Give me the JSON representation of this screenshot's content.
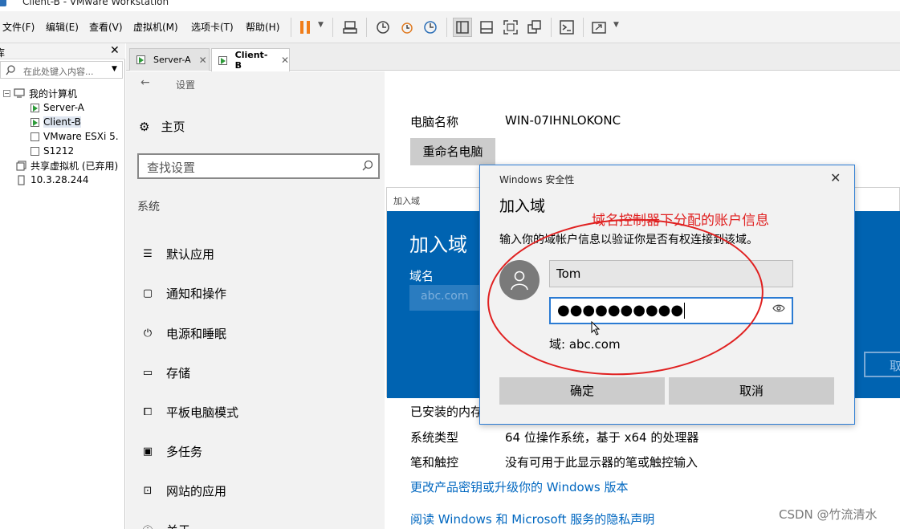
{
  "window": {
    "title": "Client-B - VMware Workstation"
  },
  "menubar": {
    "items": [
      "文件(F)",
      "编辑(E)",
      "查看(V)",
      "虚拟机(M)",
      "选项卡(T)",
      "帮助(H)"
    ]
  },
  "library": {
    "title": "库",
    "search_placeholder": "在此处键入内容...",
    "tree": {
      "root": "我的计算机",
      "vms": [
        "Server-A",
        "Client-B",
        "VMware ESXi 5.",
        "S1212"
      ],
      "shared": "共享虚拟机 (已弃用)",
      "remote": "10.3.28.244"
    }
  },
  "tabs": [
    {
      "label": "Server-A"
    },
    {
      "label": "Client-B"
    }
  ],
  "settings": {
    "back_title": "设置",
    "home": "主页",
    "search_placeholder": "查找设置",
    "section": "系统",
    "nav_items": [
      "默认应用",
      "通知和操作",
      "电源和睡眠",
      "存储",
      "平板电脑模式",
      "多任务",
      "网站的应用",
      "关于"
    ]
  },
  "about": {
    "pc_name_label": "电脑名称",
    "pc_name_value": "WIN-07IHNLOKONC",
    "rename_button": "重命名电脑",
    "ram_label": "已安装的内存",
    "system_type_label": "系统类型",
    "system_type_value": "64 位操作系统，基于 x64 的处理器",
    "pen_label": "笔和触控",
    "pen_value": "没有可用于此显示器的笔或触控输入",
    "link_upgrade": "更改产品密钥或升级你的 Windows 版本",
    "link_privacy": "阅读 Windows 和 Microsoft 服务的隐私声明"
  },
  "join_domain": {
    "window_title": "加入域",
    "heading": "加入域",
    "domain_label": "域名",
    "domain_value": "abc.com",
    "cancel_partial": "取"
  },
  "security_dialog": {
    "title": "Windows 安全性",
    "heading": "加入域",
    "description": "输入你的域帐户信息以验证你是否有权连接到该域。",
    "username": "Tom",
    "password_mask": "●●●●●●●●●●",
    "domain_line": "域: abc.com",
    "ok": "确定",
    "cancel": "取消"
  },
  "annotation": {
    "text": "域名控制器下分配的账户信息",
    "color": "#e02020"
  },
  "watermark": "CSDN @竹流清水"
}
